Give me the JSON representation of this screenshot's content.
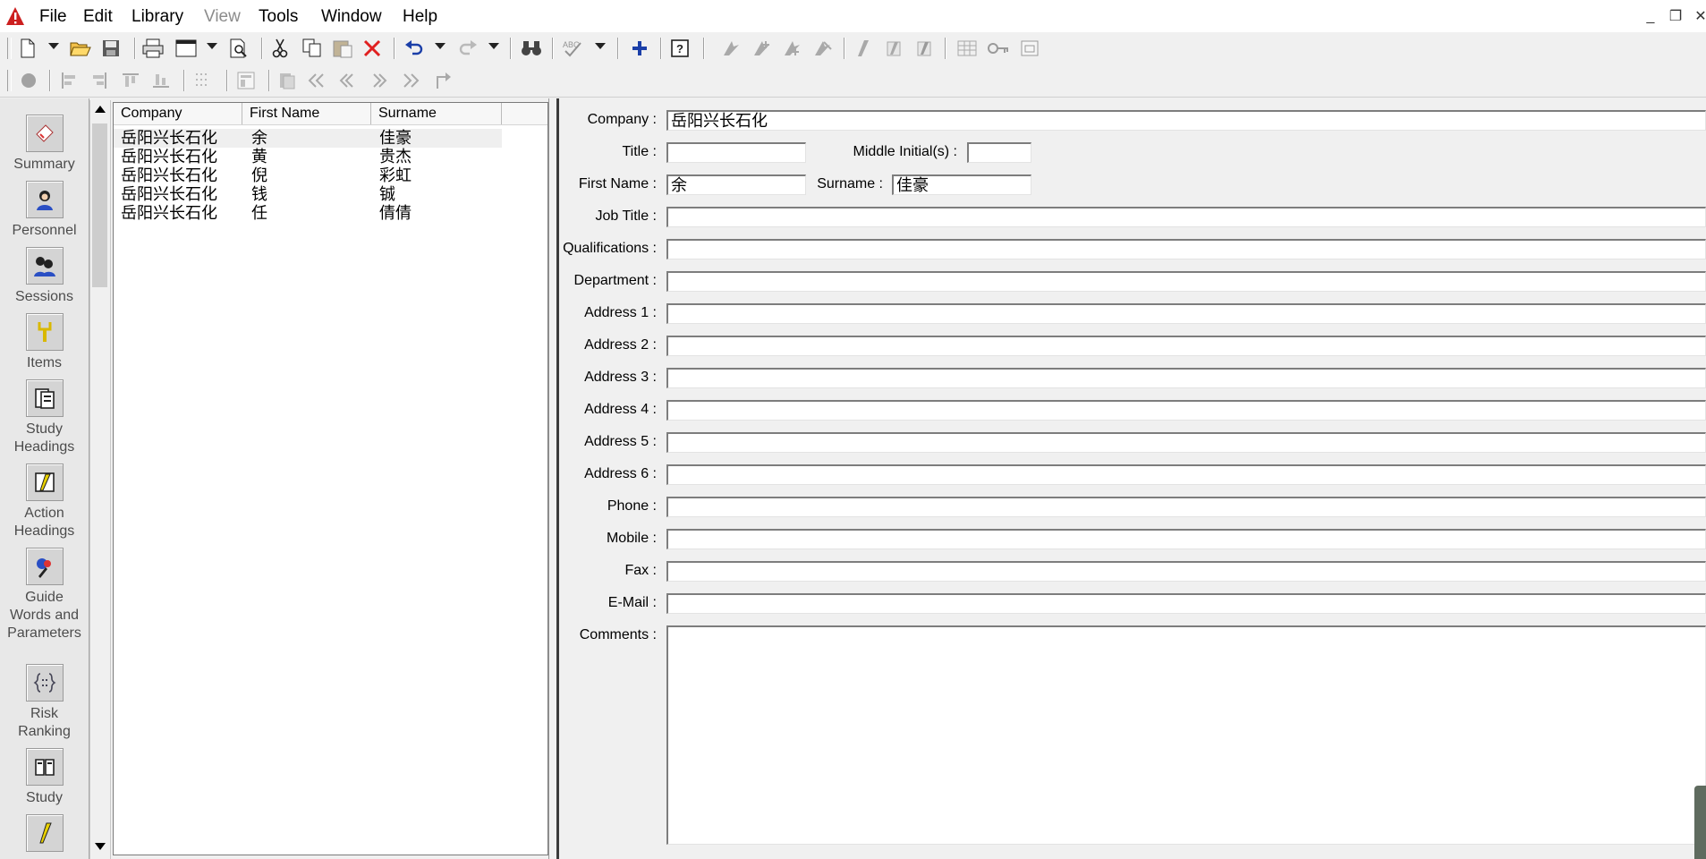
{
  "menu": {
    "items": [
      {
        "label": "File",
        "enabled": true
      },
      {
        "label": "Edit",
        "enabled": true
      },
      {
        "label": "Library",
        "enabled": true
      },
      {
        "label": "View",
        "enabled": false
      },
      {
        "label": "Tools",
        "enabled": true
      },
      {
        "label": "Window",
        "enabled": true
      },
      {
        "label": "Help",
        "enabled": true
      }
    ]
  },
  "window_controls": {
    "minimize": "_",
    "restore": "❐",
    "close": "✕"
  },
  "nav": {
    "items": [
      {
        "label": "Summary",
        "icon": "summary-icon"
      },
      {
        "label": "Personnel",
        "icon": "personnel-icon"
      },
      {
        "label": "Sessions",
        "icon": "sessions-icon"
      },
      {
        "label": "Items",
        "icon": "items-icon"
      },
      {
        "label": "Study\nHeadings",
        "icon": "study-headings-icon"
      },
      {
        "label": "Action\nHeadings",
        "icon": "action-headings-icon"
      },
      {
        "label": "Guide\nWords and\nParameters",
        "icon": "guide-words-icon"
      },
      {
        "label": "Risk\nRanking",
        "icon": "risk-ranking-icon"
      },
      {
        "label": "Study",
        "icon": "study-icon"
      },
      {
        "label": "",
        "icon": "actions-icon"
      }
    ]
  },
  "list": {
    "columns": [
      "Company",
      "First Name",
      "Surname"
    ],
    "rows": [
      [
        "岳阳兴长石化",
        "余",
        "佳豪"
      ],
      [
        "岳阳兴长石化",
        "黄",
        "贵杰"
      ],
      [
        "岳阳兴长石化",
        "倪",
        "彩虹"
      ],
      [
        "岳阳兴长石化",
        "钱",
        "铖"
      ],
      [
        "岳阳兴长石化",
        "任",
        "倩倩"
      ]
    ],
    "selected_index": 0
  },
  "form": {
    "labels": {
      "company": "Company :",
      "title": "Title :",
      "middle_initials": "Middle Initial(s) :",
      "first_name": "First Name :",
      "surname": "Surname :",
      "job_title": "Job Title :",
      "qualifications": "Qualifications :",
      "department": "Department :",
      "address1": "Address 1 :",
      "address2": "Address 2 :",
      "address3": "Address 3 :",
      "address4": "Address 4 :",
      "address5": "Address 5 :",
      "address6": "Address 6 :",
      "phone": "Phone :",
      "mobile": "Mobile :",
      "fax": "Fax :",
      "email": "E-Mail :",
      "comments": "Comments :"
    },
    "values": {
      "company": "岳阳兴长石化",
      "title": "",
      "middle_initials": "",
      "first_name": "余",
      "surname": "佳豪",
      "job_title": "",
      "qualifications": "",
      "department": "",
      "address1": "",
      "address2": "",
      "address3": "",
      "address4": "",
      "address5": "",
      "address6": "",
      "phone": "",
      "mobile": "",
      "fax": "",
      "email": "",
      "comments": ""
    }
  },
  "colors": {
    "app_icon": "#cc1f1f",
    "delete_icon": "#e02020",
    "add_icon": "#1b3fa8"
  }
}
